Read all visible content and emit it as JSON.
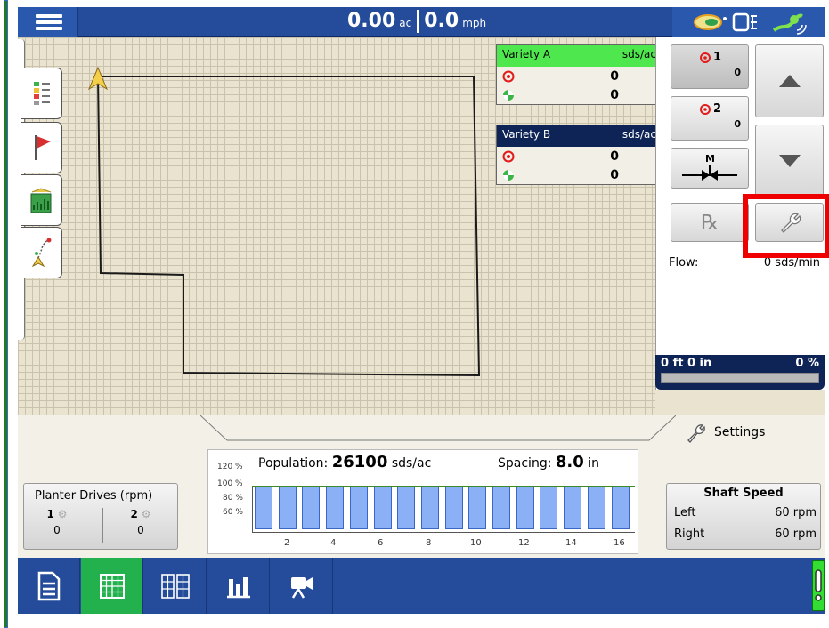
{
  "topbar": {
    "area_value": "0.00",
    "area_unit": "ac",
    "speed_value": "0.0",
    "speed_unit": "mph",
    "icons": [
      "menu-icon",
      "seed-icon",
      "display-icon",
      "gps-signal-icon"
    ]
  },
  "left_tools": [
    "legend-icon",
    "flag-icon",
    "field-chart-icon",
    "guidance-icon"
  ],
  "varieties": [
    {
      "name": "Variety A",
      "unit": "sds/ac",
      "target": "0",
      "actual": "0",
      "header_color": "#4ee84e",
      "header_text": "#000000"
    },
    {
      "name": "Variety B",
      "unit": "sds/ac",
      "target": "0",
      "actual": "0",
      "header_color": "#0e2456",
      "header_text": "#ffffff"
    }
  ],
  "controls": {
    "section_1_label": "1",
    "section_1_value": "0",
    "section_2_label": "2",
    "section_2_value": "0",
    "manual_label": "M",
    "rx_label": "℞",
    "flow_label": "Flow:",
    "flow_value": "0 sds/min",
    "progress_left": "0 ft 0 in",
    "progress_right": "0 %",
    "progress_fraction": 0
  },
  "settings": {
    "label": "Settings"
  },
  "graph": {
    "population_label": "Population:",
    "population_value": "26100",
    "population_unit": "sds/ac",
    "spacing_label": "Spacing:",
    "spacing_value": "8.0",
    "spacing_unit": "in",
    "y_ticks": [
      "120 %",
      "100 %",
      "80 %",
      "60 %"
    ],
    "x_ticks": [
      "2",
      "4",
      "6",
      "8",
      "10",
      "12",
      "14",
      "16"
    ],
    "row_count": 16
  },
  "planter_drives": {
    "title": "Planter Drives (rpm)",
    "drives": [
      {
        "id": "1",
        "value": "0"
      },
      {
        "id": "2",
        "value": "0"
      }
    ]
  },
  "shaft_speed": {
    "title": "Shaft Speed",
    "rows": [
      {
        "label": "Left",
        "value": "60 rpm"
      },
      {
        "label": "Right",
        "value": "60 rpm"
      }
    ]
  },
  "nav": {
    "buttons": [
      "summary-icon",
      "map-grid-icon",
      "split-view-icon",
      "bar-chart-icon",
      "camera-icon"
    ],
    "active_index": 1,
    "active_color": "#22b14c"
  }
}
